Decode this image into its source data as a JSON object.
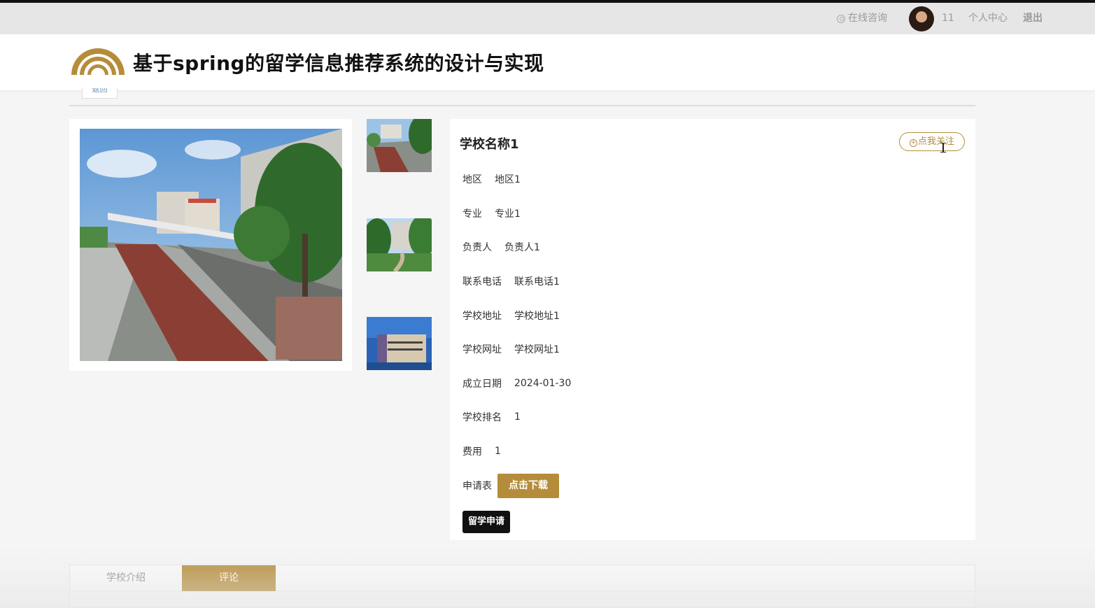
{
  "topbar": {
    "consult_label": "在线咨询",
    "username": "11",
    "center_label": "个人中心",
    "logout_label": "退出"
  },
  "header": {
    "title": "基于spring的留学信息推荐系统的设计与实现"
  },
  "back_label": "返回",
  "school": {
    "name": "学校名称1",
    "follow_label": "点我关注",
    "fields": [
      {
        "label": "地区",
        "value": "地区1"
      },
      {
        "label": "专业",
        "value": "专业1"
      },
      {
        "label": "负责人",
        "value": "负责人1"
      },
      {
        "label": "联系电话",
        "value": "联系电话1"
      },
      {
        "label": "学校地址",
        "value": "学校地址1"
      },
      {
        "label": "学校网址",
        "value": "学校网址1"
      },
      {
        "label": "成立日期",
        "value": "2024-01-30"
      },
      {
        "label": "学校排名",
        "value": "1"
      },
      {
        "label": "费用",
        "value": "1"
      }
    ],
    "form_label": "申请表",
    "download_label": "点击下载",
    "apply_label": "留学申请"
  },
  "tabs": [
    {
      "label": "学校介绍"
    },
    {
      "label": "评论"
    }
  ],
  "colors": {
    "accent": "#b58d3a",
    "dark": "#111111"
  }
}
